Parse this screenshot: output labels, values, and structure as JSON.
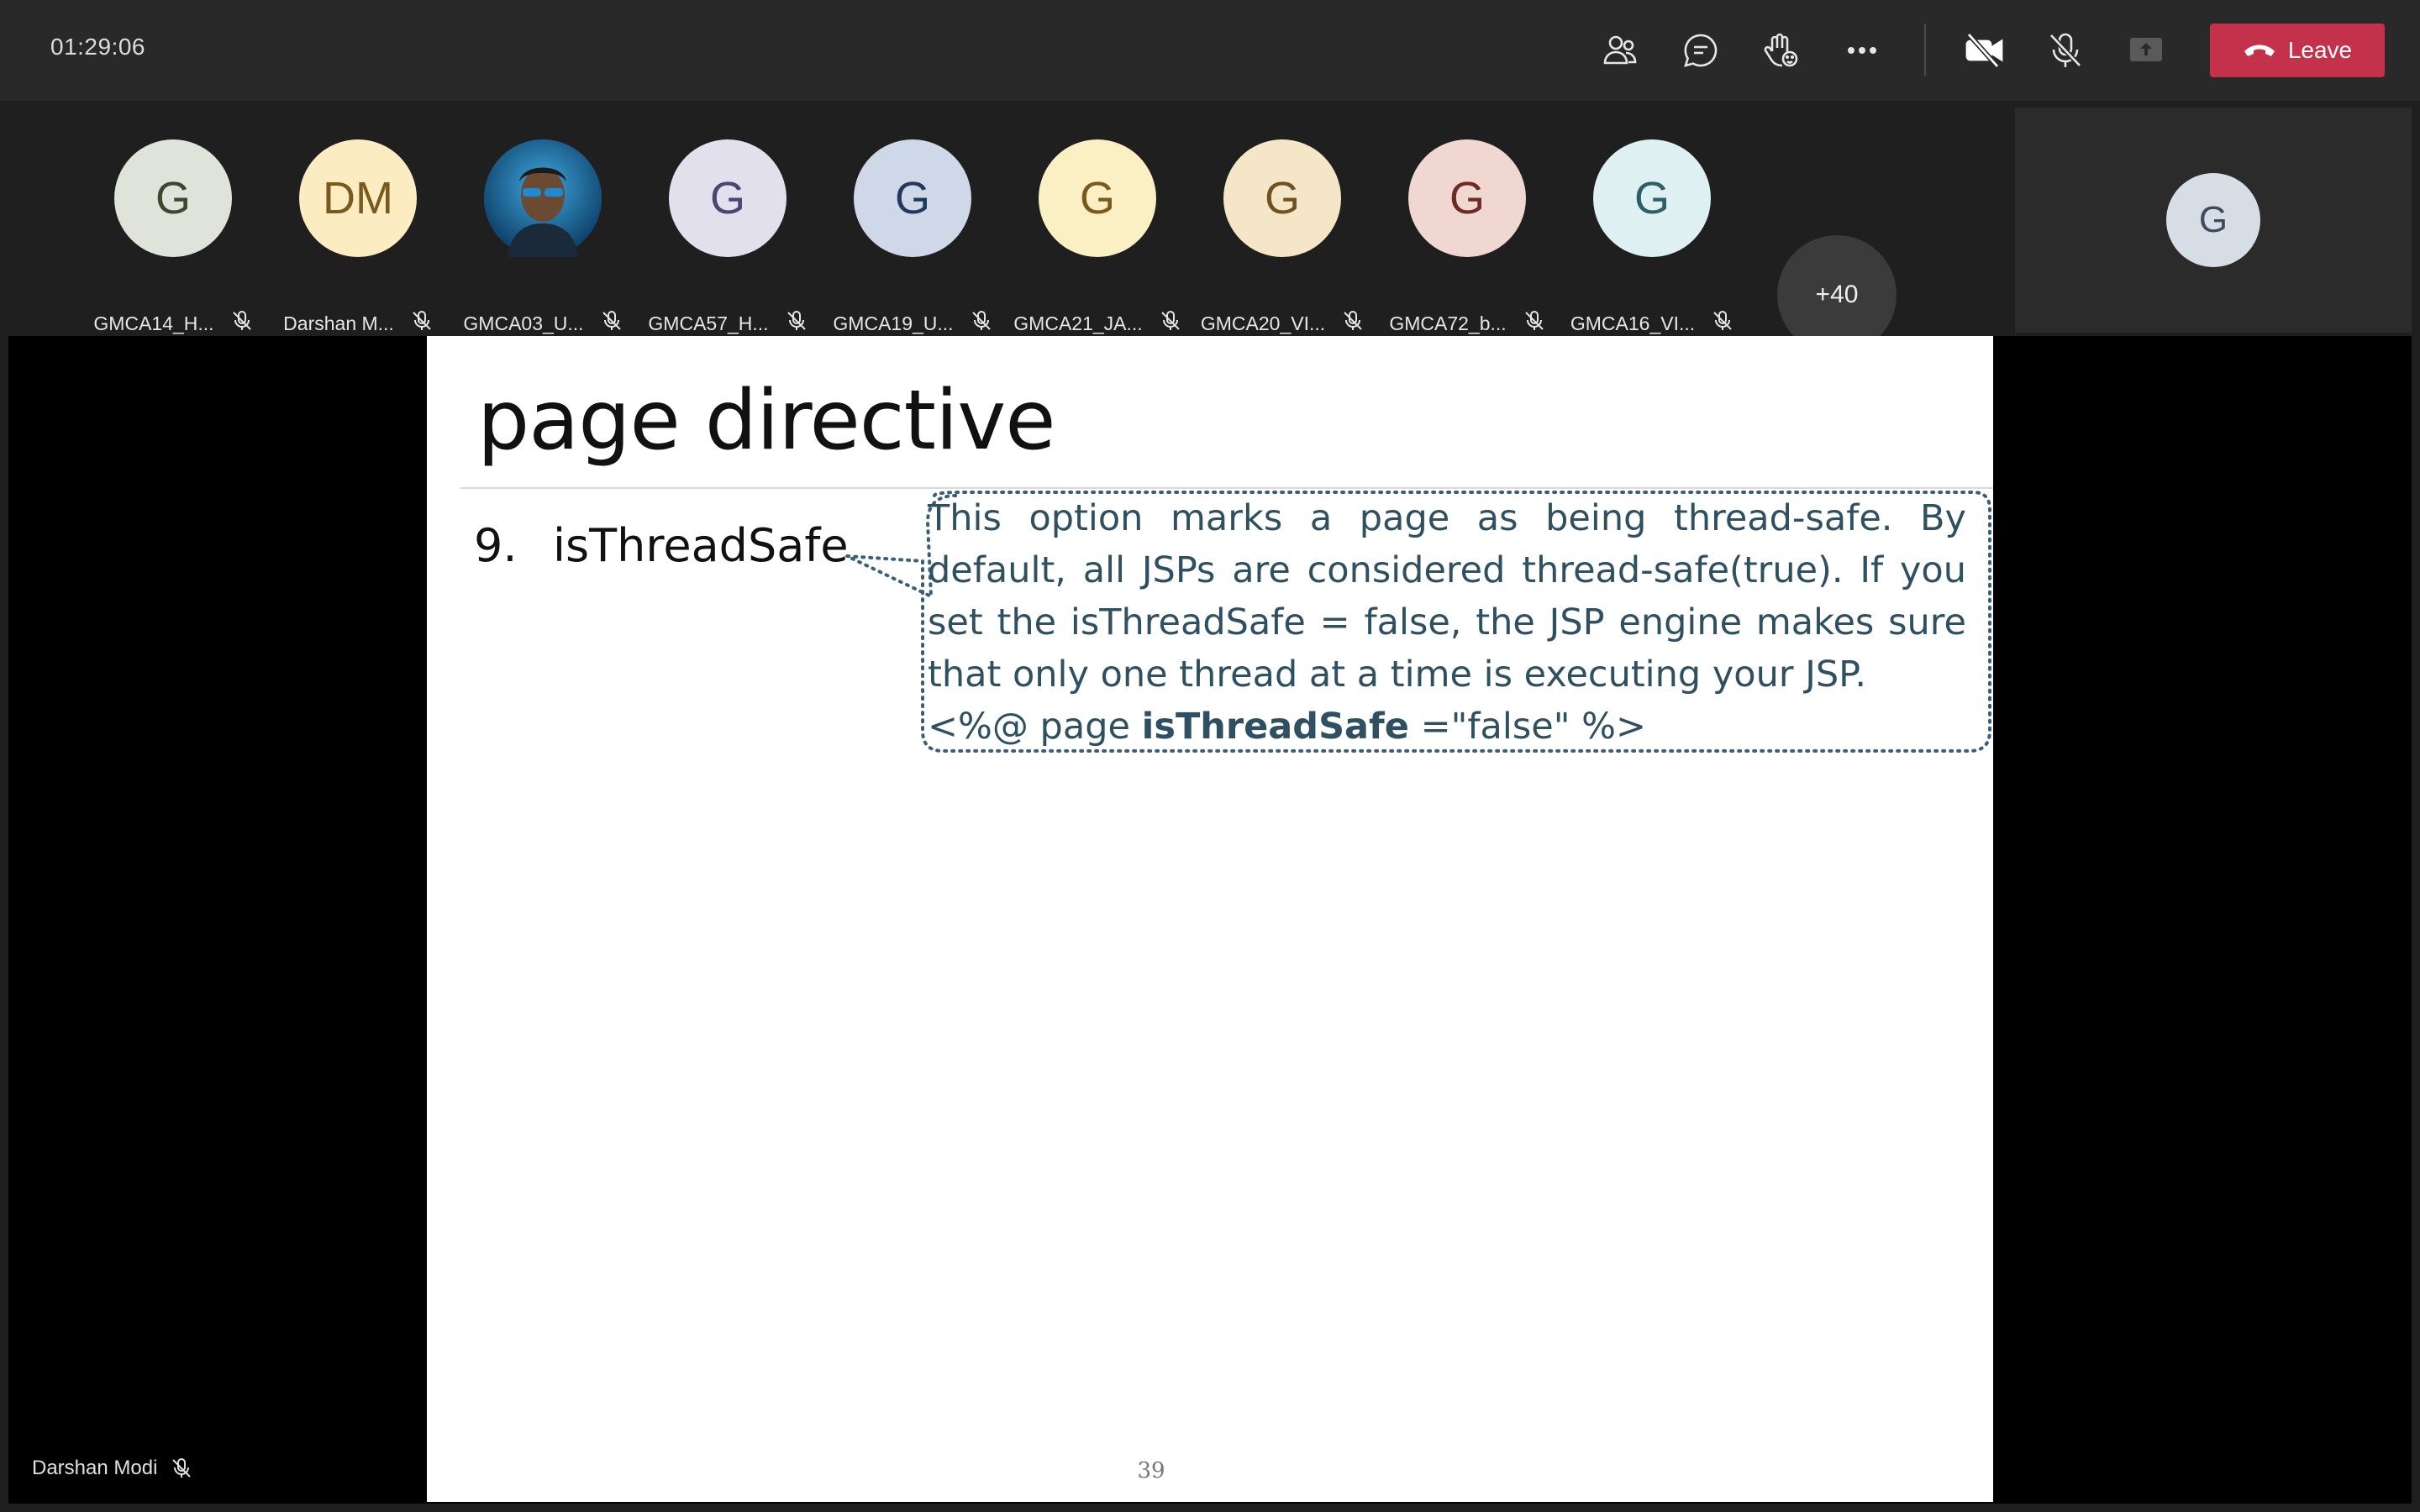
{
  "meeting": {
    "timer": "01:29:06",
    "leave_label": "Leave",
    "controls": [
      "people-icon",
      "chat-icon",
      "raise-hand-icon",
      "more-icon",
      "camera-off-icon",
      "mic-off-icon",
      "share-icon"
    ]
  },
  "participants": [
    {
      "initials": "G",
      "name": "GMCA14_H...",
      "bg": "#dfe3d9",
      "fg": "#3f4630"
    },
    {
      "initials": "DM",
      "name": "Darshan M...",
      "bg": "#fbecc2",
      "fg": "#7a5a1c"
    },
    {
      "initials": "",
      "name": "GMCA03_U...",
      "bg": "#1e6a9c",
      "fg": "#ffffff",
      "photo": true
    },
    {
      "initials": "G",
      "name": "GMCA57_H...",
      "bg": "#e3e0ee",
      "fg": "#4b4570"
    },
    {
      "initials": "G",
      "name": "GMCA19_U...",
      "bg": "#cfd8e8",
      "fg": "#22385c"
    },
    {
      "initials": "G",
      "name": "GMCA21_JA...",
      "bg": "#fbefc4",
      "fg": "#7a5a1c"
    },
    {
      "initials": "G",
      "name": "GMCA20_VI...",
      "bg": "#f5e6c8",
      "fg": "#6e5220"
    },
    {
      "initials": "G",
      "name": "GMCA72_b...",
      "bg": "#f0d7d2",
      "fg": "#6e2a22"
    },
    {
      "initials": "G",
      "name": "GMCA16_VI...",
      "bg": "#def0f1",
      "fg": "#2b6166"
    }
  ],
  "overflow_count": "+40",
  "self_view": {
    "initials": "G"
  },
  "slide": {
    "title": "page directive",
    "item_number": "9.",
    "item_label": "isThreadSafe",
    "description": "This option marks a page as being thread-safe. By default, all JSPs are considered thread-safe(true). If you set the isThreadSafe = false, the JSP engine makes sure that only one thread at a time is executing your JSP.",
    "code_prefix": "<%@ page ",
    "code_keyword": "isThreadSafe",
    "code_suffix": " =\"false\"  %>",
    "page_number": "39"
  },
  "presenter_name": "Darshan Modi"
}
